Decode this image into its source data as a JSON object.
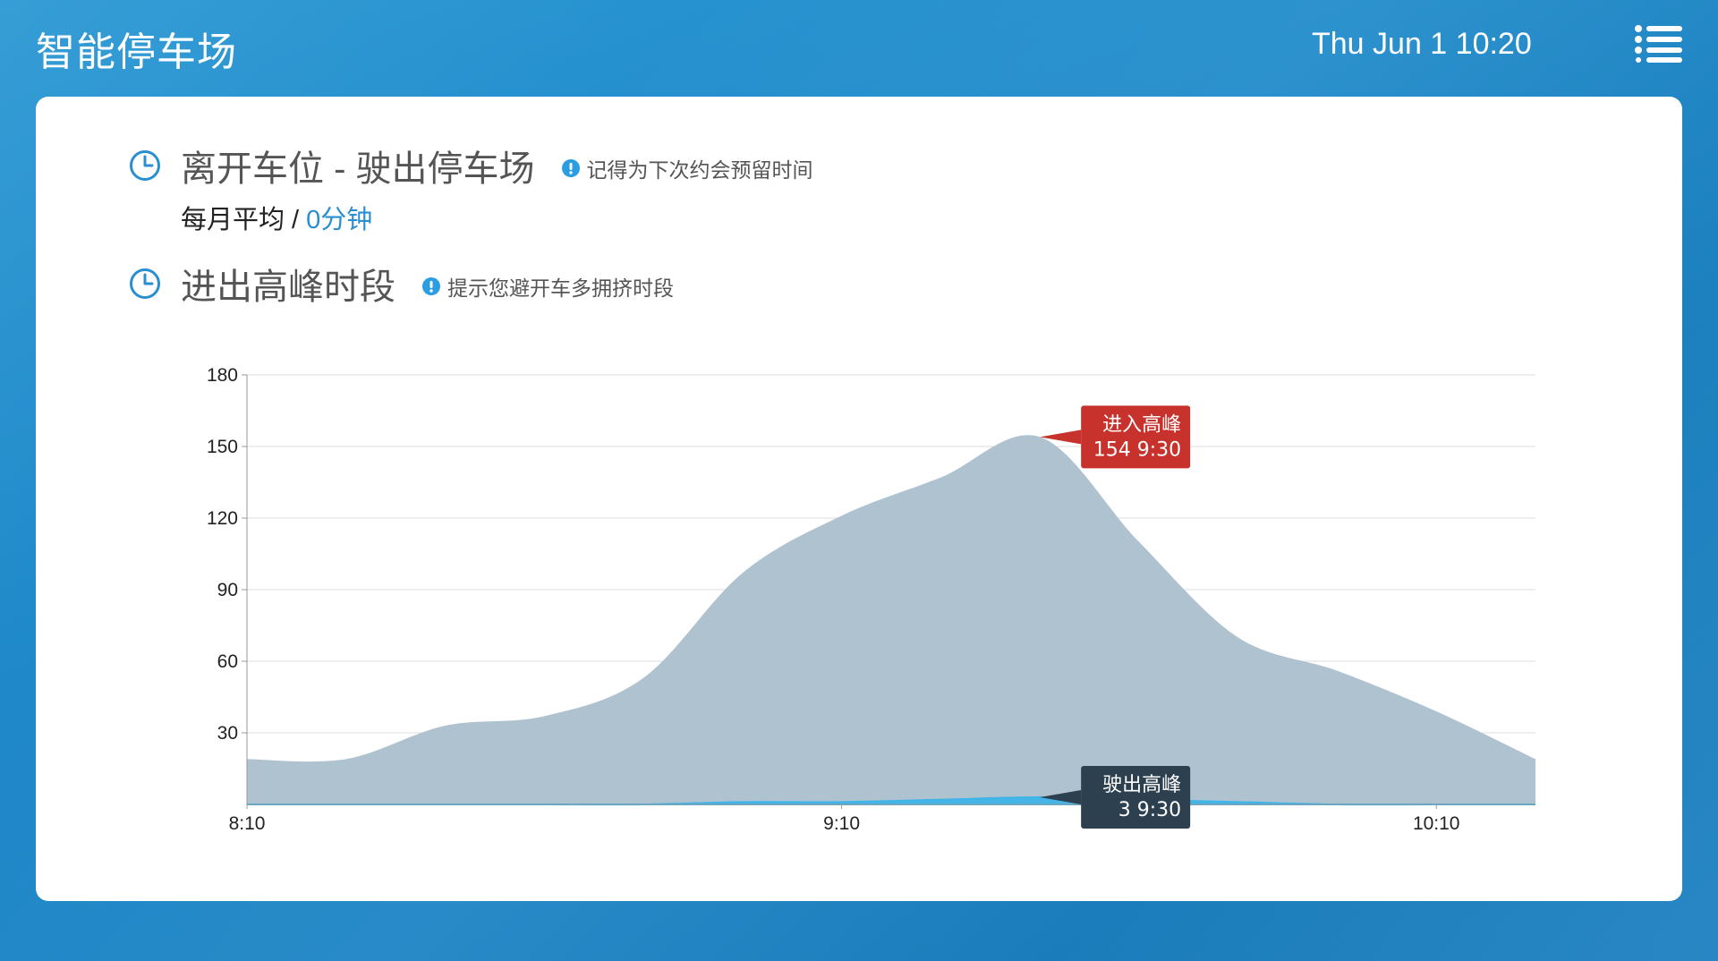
{
  "header": {
    "title": "智能停车场",
    "datetime": "Thu Jun 1 10:20",
    "menu_icon": "list-menu-icon"
  },
  "colors": {
    "background": "#1e88c8",
    "accent": "#2a8fd0",
    "area_enter": "#afc2cf",
    "area_exit": "#3fb4e8",
    "tooltip_enter": "#c7332c",
    "tooltip_exit": "#2d4050"
  },
  "leaving": {
    "icon": "clock-icon",
    "heading": "离开车位 - 驶出停车场",
    "hint": "记得为下次约会预留时间",
    "avg_label": "每月平均 / ",
    "avg_value": "0分钟"
  },
  "peak": {
    "icon": "clock-icon",
    "heading": "进出高峰时段",
    "hint": "提示您避开车多拥挤时段"
  },
  "chart_data": {
    "type": "area",
    "title": "",
    "xlabel": "",
    "ylabel": "",
    "ylim": [
      0,
      180
    ],
    "y_ticks": [
      30,
      60,
      90,
      120,
      150,
      180
    ],
    "x_ticks": [
      "8:10",
      "9:10",
      "10:10"
    ],
    "x": [
      "8:10",
      "8:20",
      "8:30",
      "8:40",
      "8:50",
      "9:00",
      "9:10",
      "9:20",
      "9:30",
      "9:40",
      "9:50",
      "10:00",
      "10:10",
      "10:20"
    ],
    "grid": true,
    "series": [
      {
        "name": "进入",
        "values": [
          19,
          19,
          33,
          37,
          53,
          97,
          121,
          137,
          154,
          110,
          70,
          56,
          39,
          19
        ]
      },
      {
        "name": "驶出",
        "values": [
          0,
          0,
          0,
          0,
          0,
          1,
          1,
          2,
          3,
          2,
          1,
          0,
          0,
          0
        ]
      }
    ],
    "annotations": [
      {
        "label": "进入高峰",
        "value": "154",
        "time": "9:30"
      },
      {
        "label": "驶出高峰",
        "value": "3",
        "time": "9:30"
      }
    ]
  }
}
